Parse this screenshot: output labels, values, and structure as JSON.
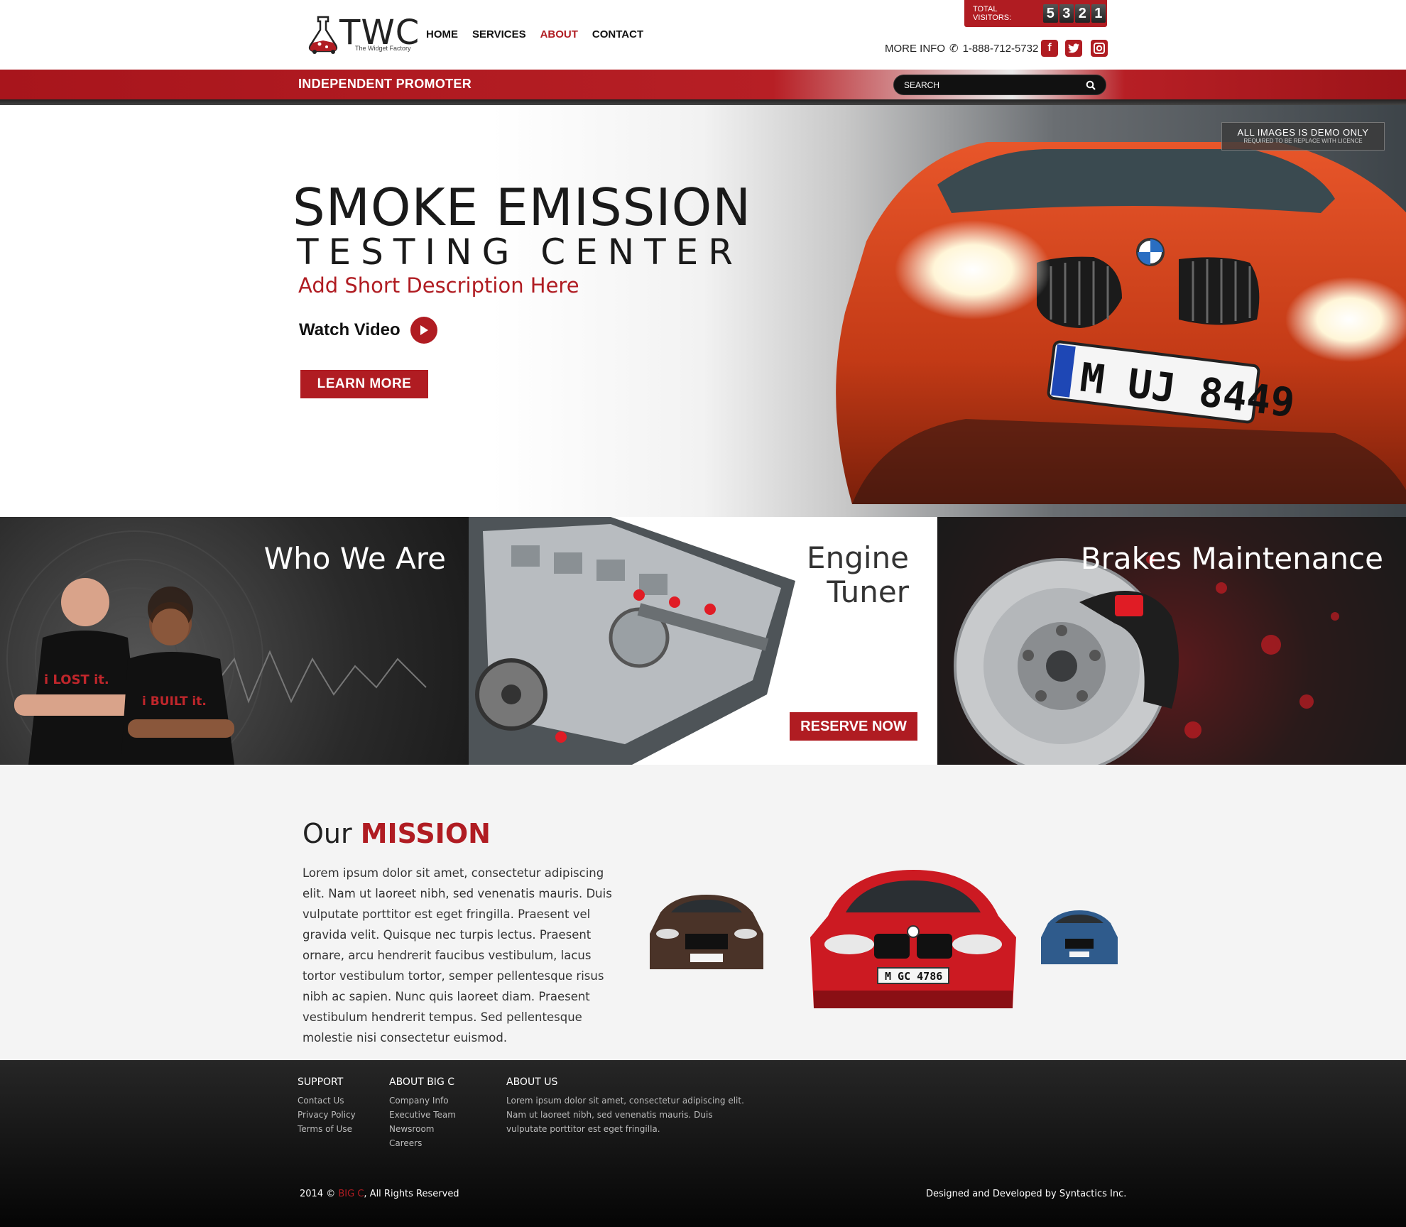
{
  "header": {
    "logo_text": "TWC",
    "logo_sub": "The Widget Factory",
    "nav": [
      {
        "label": "HOME",
        "active": false
      },
      {
        "label": "SERVICES",
        "active": false
      },
      {
        "label": "ABOUT",
        "active": true
      },
      {
        "label": "CONTACT",
        "active": false
      }
    ],
    "visitors_label": "TOTAL VISITORS:",
    "visitor_digits": [
      "5",
      "3",
      "2",
      "1"
    ],
    "more_info": "MORE INFO",
    "phone": "1-888-712-5732",
    "social": [
      "facebook-icon",
      "twitter-icon",
      "instagram-icon"
    ]
  },
  "bar": {
    "promoter": "INDEPENDENT PROMOTER",
    "search_placeholder": "SEARCH"
  },
  "hero": {
    "title": "SMOKE EMISSION",
    "subtitle": "TESTING CENTER",
    "description": "Add Short Description Here",
    "watch_label": "Watch Video",
    "learn_label": "LEARN MORE",
    "demo_line1": "ALL IMAGES IS DEMO ONLY",
    "demo_line2": "REQUIRED TO BE REPLACE WITH LICENCE",
    "plate": "M UJ 8449"
  },
  "panels": {
    "who": "Who We Are",
    "engine_1": "Engine",
    "engine_2": "Tuner",
    "reserve": "RESERVE NOW",
    "brakes": "Brakes Maintenance"
  },
  "mission": {
    "title_a": "Our ",
    "title_b": "MISSION",
    "text": "Lorem ipsum dolor sit amet, consectetur adipiscing elit. Nam ut laoreet nibh, sed venenatis mauris. Duis vulputate porttitor est eget fringilla. Praesent vel gravida velit. Quisque nec turpis lectus. Praesent ornare, arcu hendrerit faucibus vestibulum, lacus tortor vestibulum tortor, semper pellentesque risus nibh ac sapien. Nunc quis laoreet diam. Praesent vestibulum hendrerit tempus. Sed pellentesque molestie nisi consectetur euismod.",
    "plate_center": "M GC 4786"
  },
  "footer": {
    "support_title": "SUPPORT",
    "support_links": [
      "Contact Us",
      "Privacy Policy",
      "Terms of Use"
    ],
    "about_big_title": "ABOUT BIG C",
    "about_big_links": [
      "Company Info",
      "Executive Team",
      "Newsroom",
      "Careers"
    ],
    "about_us_title": "ABOUT US",
    "about_us_text": "Lorem ipsum dolor sit amet, consectetur adipiscing elit. Nam ut laoreet nibh, sed venenatis mauris. Duis vulputate porttitor est eget fringilla.",
    "copy_a": "2014 © ",
    "copy_b": "BIG C",
    "copy_c": ", All Rights Reserved",
    "credit": "Designed and Developed by Syntactics Inc."
  },
  "colors": {
    "accent": "#b01c22",
    "dark": "#1a1a1a"
  }
}
